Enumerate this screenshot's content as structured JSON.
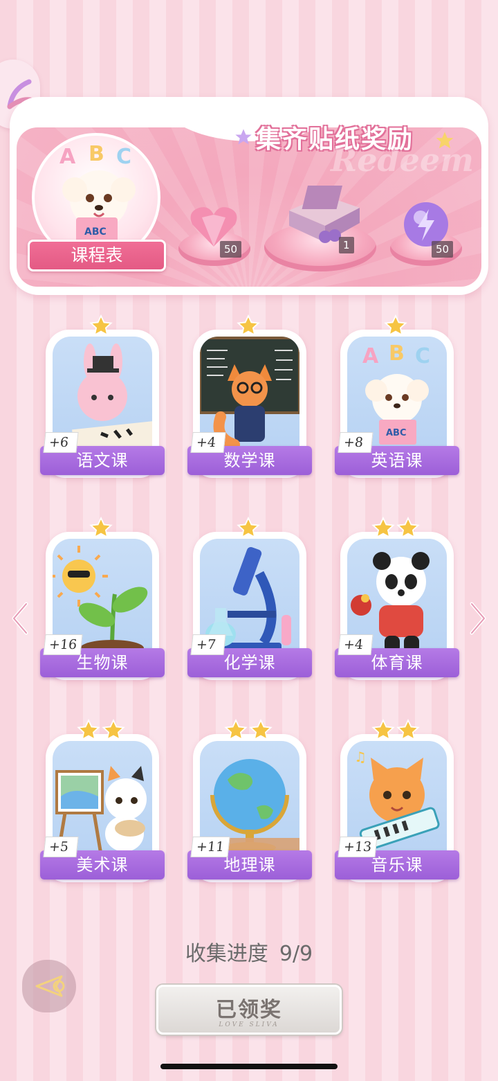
{
  "header": {
    "title": "集齐贴纸奖励",
    "watermark": "Redeem",
    "schedule_label": "课程表",
    "schedule_letters": [
      "A",
      "B",
      "C"
    ],
    "book_text": "ABC",
    "rewards": [
      {
        "icon": "pink-heart-gem-icon",
        "count": "50"
      },
      {
        "icon": "gift-box-icon",
        "count": "1"
      },
      {
        "icon": "purple-orb-icon",
        "count": "50"
      }
    ]
  },
  "cards": [
    {
      "label": "语文课",
      "count": "+6",
      "stars": 1,
      "art": "bunny-calligraphy"
    },
    {
      "label": "数学课",
      "count": "+4",
      "stars": 1,
      "art": "fox-teacher"
    },
    {
      "label": "英语课",
      "count": "+8",
      "stars": 1,
      "art": "puppy-abc"
    },
    {
      "label": "生物课",
      "count": "+16",
      "stars": 1,
      "art": "sun-sprout"
    },
    {
      "label": "化学课",
      "count": "+7",
      "stars": 1,
      "art": "microscope"
    },
    {
      "label": "体育课",
      "count": "+4",
      "stars": 2,
      "art": "panda-pingpong"
    },
    {
      "label": "美术课",
      "count": "+5",
      "stars": 2,
      "art": "cat-painter"
    },
    {
      "label": "地理课",
      "count": "+11",
      "stars": 2,
      "art": "globe"
    },
    {
      "label": "音乐课",
      "count": "+13",
      "stars": 2,
      "art": "cat-keyboard"
    }
  ],
  "progress": {
    "label": "收集进度",
    "value": "9/9"
  },
  "claim_button": {
    "label": "已领奖",
    "sub": "LOVE SLIVA"
  },
  "colors": {
    "accent_pink": "#e45a84",
    "label_purple": "#9c5fd8",
    "star_gold": "#f6c443"
  }
}
